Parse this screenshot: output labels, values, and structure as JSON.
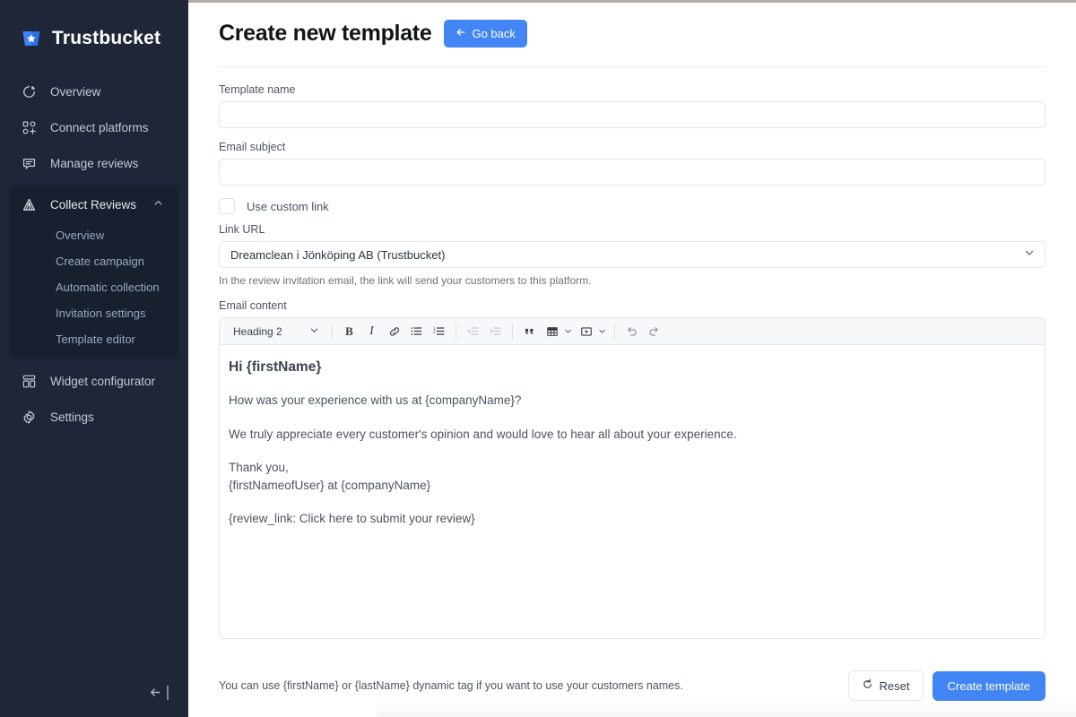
{
  "brand": {
    "name": "Trustbucket",
    "logo_icon": "bucket-star-icon",
    "accent": "#4285f4"
  },
  "sidebar": {
    "items": [
      {
        "label": "Overview",
        "icon": "pie-chart-icon"
      },
      {
        "label": "Connect platforms",
        "icon": "grid-plus-icon"
      },
      {
        "label": "Manage reviews",
        "icon": "chat-bubble-icon"
      }
    ],
    "group": {
      "label": "Collect Reviews",
      "icon": "megaphone-icon",
      "chevron": "chevron-up-icon",
      "expanded": true,
      "sub_items": [
        {
          "label": "Overview"
        },
        {
          "label": "Create campaign"
        },
        {
          "label": "Automatic collection"
        },
        {
          "label": "Invitation settings"
        },
        {
          "label": "Template editor"
        }
      ]
    },
    "items_after": [
      {
        "label": "Widget configurator",
        "icon": "layout-icon"
      },
      {
        "label": "Settings",
        "icon": "gear-icon"
      }
    ],
    "collapse_icon": "arrow-left-to-bar-icon"
  },
  "header": {
    "title": "Create new template",
    "go_back_label": "Go back",
    "go_back_icon": "arrow-left-icon"
  },
  "form": {
    "template_name": {
      "label": "Template name",
      "value": "",
      "placeholder": ""
    },
    "email_subject": {
      "label": "Email subject",
      "value": "",
      "placeholder": ""
    },
    "use_custom_link": {
      "label": "Use custom link",
      "checked": false
    },
    "link_url": {
      "label": "Link URL",
      "selected": "Dreamclean i Jönköping AB (Trustbucket)",
      "chevron": "chevron-down-icon",
      "helper": "In the review invitation email, the link will send your customers to this platform."
    },
    "email_content": {
      "label": "Email content"
    }
  },
  "editor": {
    "toolbar": {
      "block_format": {
        "value": "Heading 2",
        "chevron": "chevron-down-icon"
      },
      "buttons": [
        {
          "name": "bold-icon",
          "glyph": "B",
          "disabled": false
        },
        {
          "name": "italic-icon",
          "glyph": "I",
          "disabled": false
        },
        {
          "name": "link-icon",
          "glyph": "link",
          "disabled": false
        },
        {
          "name": "bullet-list-icon",
          "glyph": "ul",
          "disabled": false
        },
        {
          "name": "numbered-list-icon",
          "glyph": "ol",
          "disabled": false
        },
        {
          "name": "outdent-icon",
          "glyph": "outdent",
          "disabled": true
        },
        {
          "name": "indent-icon",
          "glyph": "indent",
          "disabled": true
        },
        {
          "name": "blockquote-icon",
          "glyph": "“",
          "disabled": false
        },
        {
          "name": "table-icon",
          "glyph": "table",
          "disabled": false
        },
        {
          "name": "media-icon",
          "glyph": "media",
          "disabled": false
        },
        {
          "name": "undo-icon",
          "glyph": "undo",
          "disabled": false
        },
        {
          "name": "redo-icon",
          "glyph": "redo",
          "disabled": false
        }
      ]
    },
    "content": {
      "heading": "Hi {firstName}",
      "paragraph_1": "How was your experience with us at {companyName}?",
      "paragraph_2": "We truly appreciate every customer's opinion and would love to hear all about your experience.",
      "paragraph_3_line_1": "Thank you,",
      "paragraph_3_line_2": "{firstNameofUser} at {companyName}",
      "paragraph_4": "{review_link: Click here to submit your review}"
    }
  },
  "footer": {
    "note": "You can use {firstName} or {lastName} dynamic tag if you want to use your customers names.",
    "reset_label": "Reset",
    "reset_icon": "refresh-icon",
    "create_label": "Create template"
  }
}
